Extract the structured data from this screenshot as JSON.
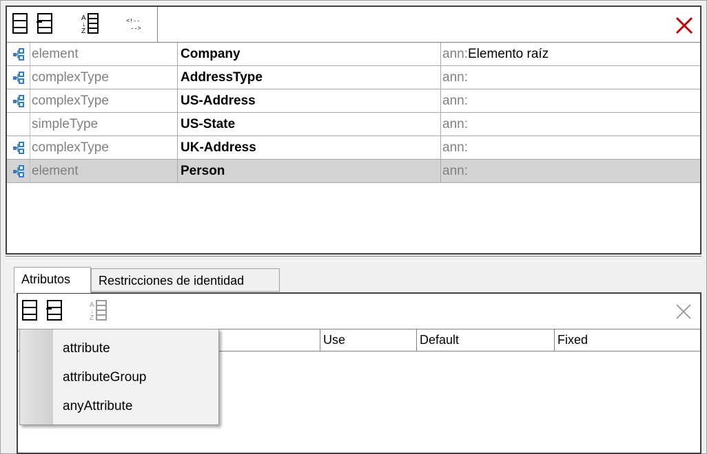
{
  "top_toolbar": {
    "buttons": [
      "append-icon",
      "insert-icon",
      "sort-az-icon",
      "comment-icon"
    ],
    "close_icon": "close-icon",
    "close_color": "#cc0000"
  },
  "components": [
    {
      "icon": "component-tree-icon",
      "kind": "element",
      "name": "Company",
      "ann_prefix": "ann:",
      "ann_value": "Elemento raíz"
    },
    {
      "icon": "component-tree-icon",
      "kind": "complexType",
      "name": "AddressType",
      "ann_prefix": "ann:",
      "ann_value": ""
    },
    {
      "icon": "component-tree-icon",
      "kind": "complexType",
      "name": "US-Address",
      "ann_prefix": "ann:",
      "ann_value": ""
    },
    {
      "icon": "",
      "kind": "simpleType",
      "name": "US-State",
      "ann_prefix": "ann:",
      "ann_value": ""
    },
    {
      "icon": "component-tree-icon",
      "kind": "complexType",
      "name": "UK-Address",
      "ann_prefix": "ann:",
      "ann_value": ""
    },
    {
      "icon": "component-tree-icon",
      "kind": "element",
      "name": "Person",
      "ann_prefix": "ann:",
      "ann_value": "",
      "selected": true
    }
  ],
  "tabs": [
    {
      "label": "Atributos",
      "active": true
    },
    {
      "label": "Restricciones de identidad",
      "active": false
    }
  ],
  "attr_table": {
    "columns": [
      "Use",
      "Default",
      "Fixed"
    ]
  },
  "popup_menu": {
    "items": [
      "attribute",
      "attributeGroup",
      "anyAttribute"
    ]
  }
}
